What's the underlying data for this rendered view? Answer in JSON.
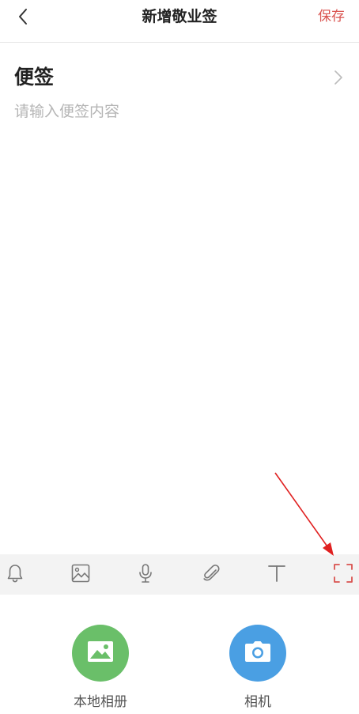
{
  "header": {
    "title": "新增敬业签",
    "save_label": "保存"
  },
  "note": {
    "title": "便签",
    "content_value": "",
    "content_placeholder": "请输入便签内容"
  },
  "toolbar": {
    "tools": [
      "bell-icon",
      "image-icon",
      "microphone-icon",
      "paperclip-icon",
      "text-format-icon",
      "fullscreen-icon"
    ],
    "icon_color": "#777777",
    "highlight_color": "#d9534f"
  },
  "picker": {
    "gallery_label": "本地相册",
    "gallery_color": "#6abf69",
    "camera_label": "相机",
    "camera_color": "#4a9fe3"
  },
  "colors": {
    "accent": "#d9534f",
    "toolbar_bg": "#f3f3f3"
  }
}
